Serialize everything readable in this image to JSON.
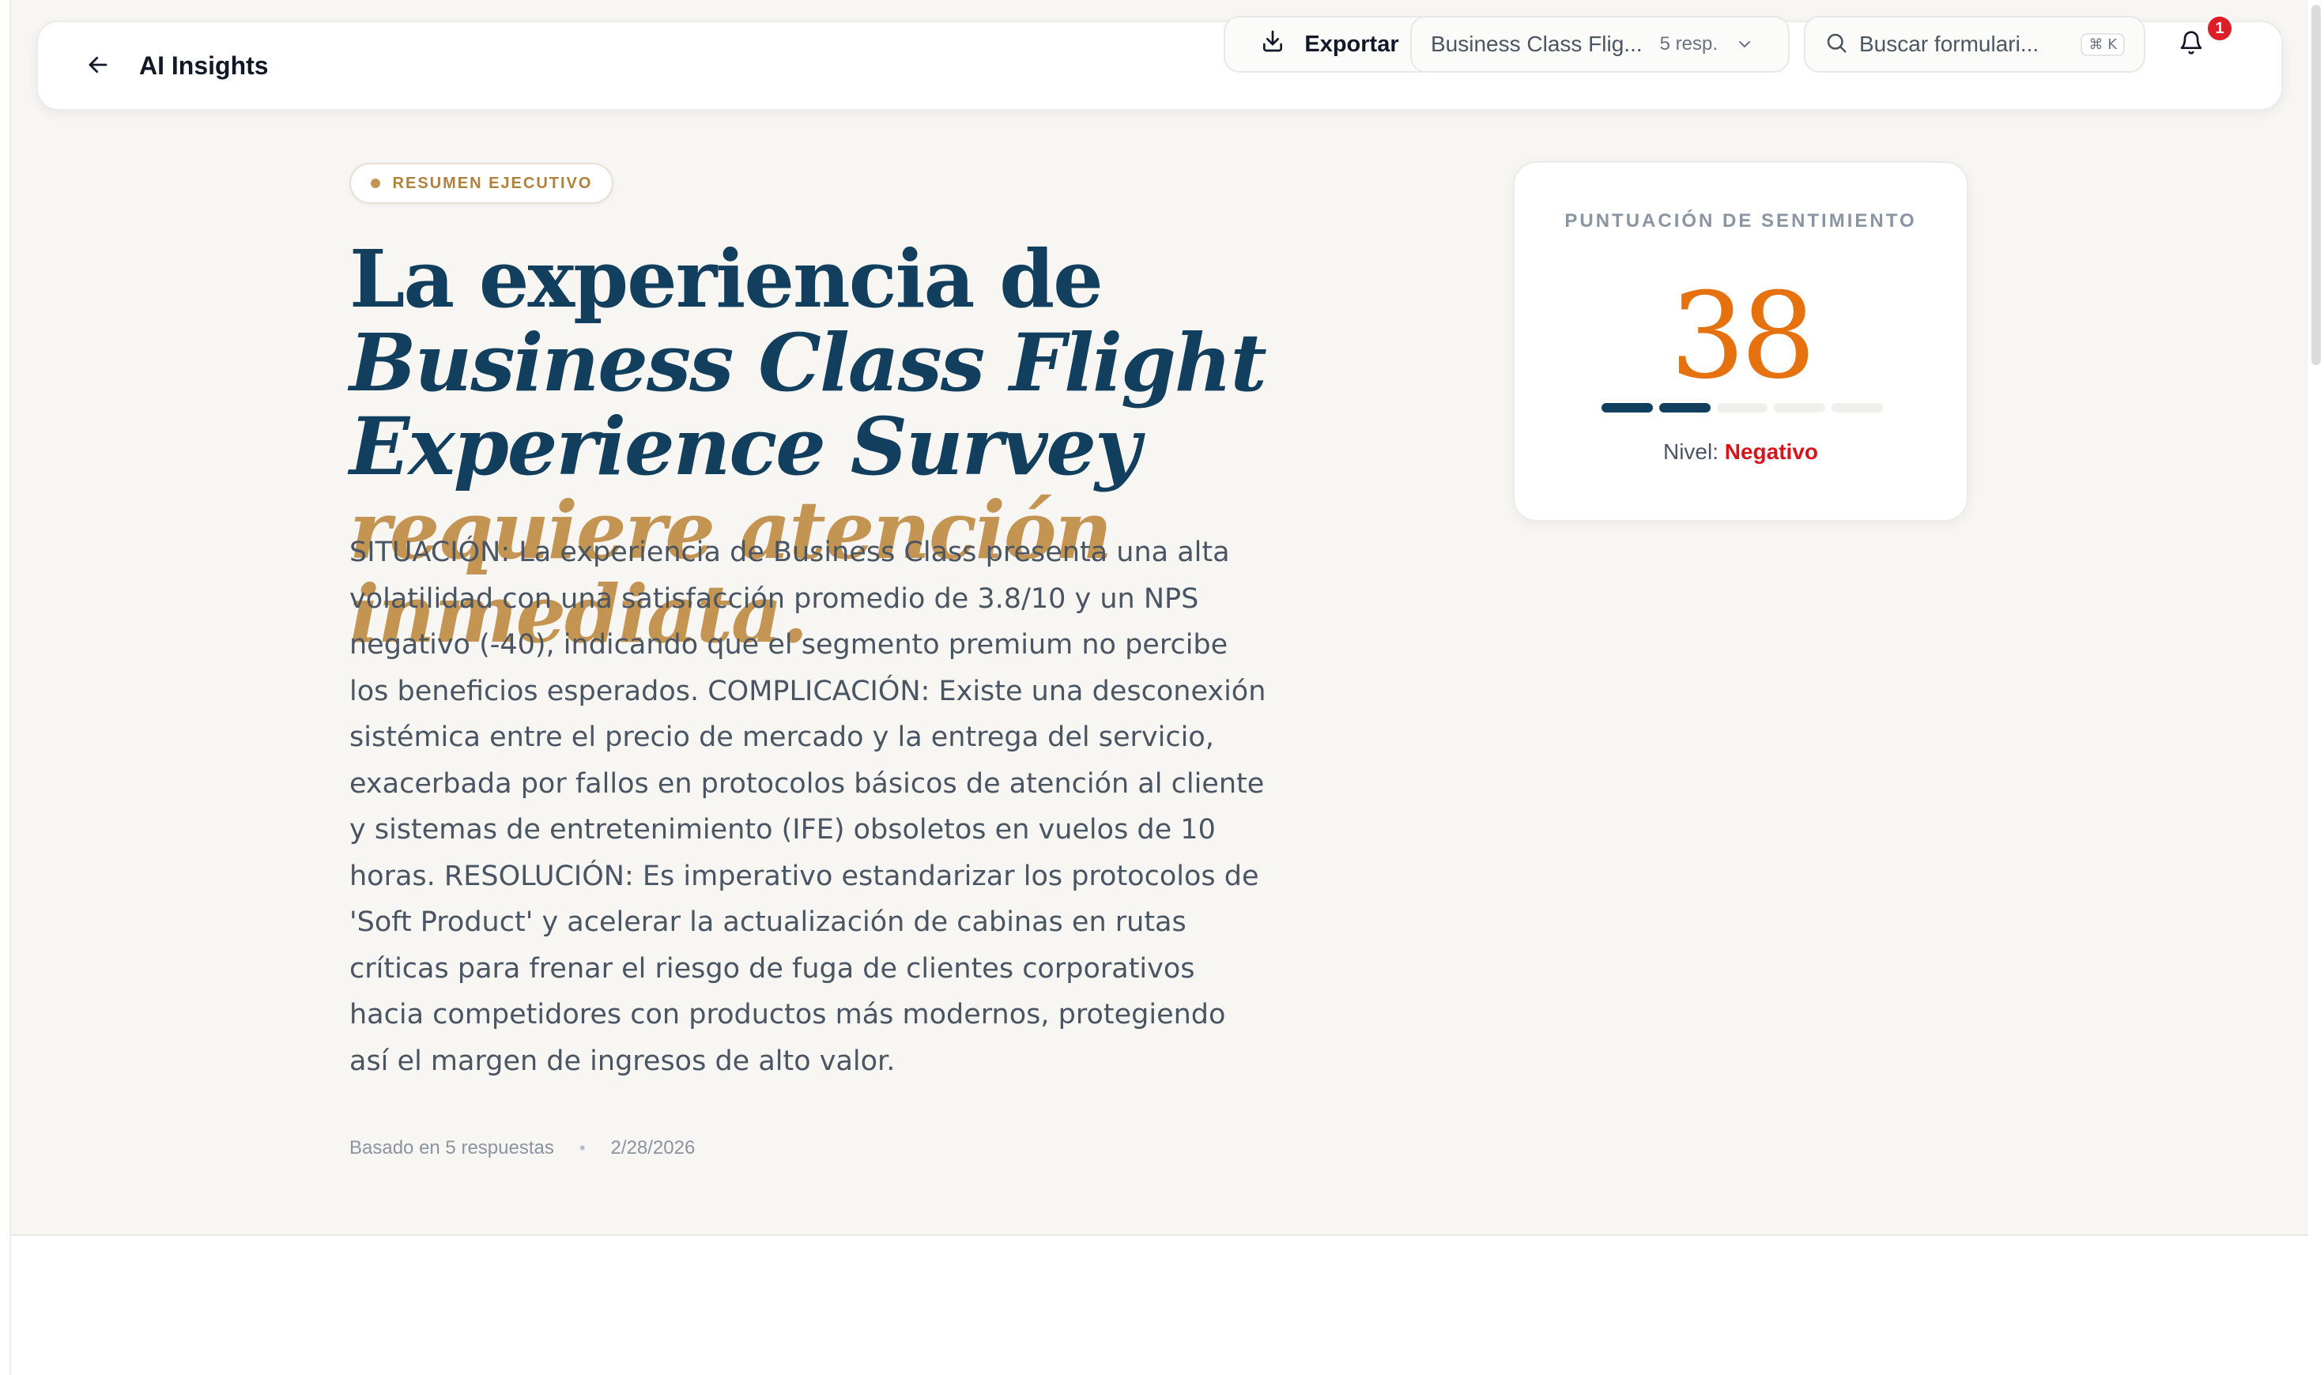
{
  "header": {
    "title": "AI Insights",
    "export_label": "Exportar",
    "form_selector": {
      "selected": "Business Class Flig...",
      "count": "5 resp."
    },
    "search": {
      "placeholder": "Buscar formulari...",
      "shortcut": "⌘ K"
    },
    "notifications": {
      "count": "1"
    }
  },
  "summary": {
    "badge": "RESUMEN EJECUTIVO",
    "headline": {
      "part1": "La experiencia de ",
      "survey_name": "Business Class Flight Experience Survey",
      "part2": "requiere atención inmediata."
    },
    "body": "SITUACIÓN: La experiencia de Business Class presenta una alta volatilidad con una satisfacción promedio de 3.8/10 y un NPS negativo (-40), indicando que el segmento premium no percibe los beneficios esperados. COMPLICACIÓN: Existe una desconexión sistémica entre el precio de mercado y la entrega del servicio, exacerbada por fallos en protocolos básicos de atención al cliente y sistemas de entretenimiento (IFE) obsoletos en vuelos de 10 horas. RESOLUCIÓN: Es imperativo estandarizar los protocolos de 'Soft Product' y acelerar la actualización de cabinas en rutas críticas para frenar el riesgo de fuga de clientes corporativos hacia competidores con productos más modernos, protegiendo así el margen de ingresos de alto valor.",
    "based_on": "Basado en 5 respuestas",
    "date": "2/28/2026"
  },
  "sentiment": {
    "label": "PUNTUACIÓN DE SENTIMIENTO",
    "score": "38",
    "level_label": "Nivel:",
    "level_value": "Negativo",
    "segments_filled": 2,
    "segments_total": 5
  },
  "colors": {
    "navy": "#123f5e",
    "gold": "#c49552",
    "score_orange": "#e6720f",
    "negative_red": "#d5141b",
    "badge_red": "#dc1f26",
    "panel_bg": "#f7f6f3"
  }
}
